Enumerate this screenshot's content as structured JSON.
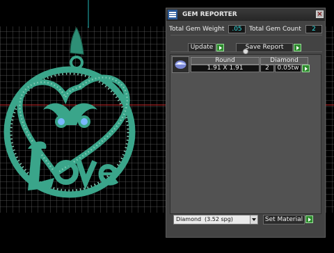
{
  "viewport": {
    "name": "3d-design-viewport",
    "grid_color": "#6e6e6e",
    "model_color": "#3aa58a",
    "gem_color": "#7ab8ff"
  },
  "panel": {
    "title": "GEM REPORTER",
    "close_glyph": "×",
    "total_weight_label": "Total Gem Weight",
    "total_weight_value": ".05",
    "total_count_label": "Total Gem Count",
    "total_count_value": "2",
    "update_label": "Update",
    "save_report_label": "Save Report",
    "table": {
      "headers": [
        "Round",
        "Diamond"
      ],
      "rows": [
        {
          "size": "1.91 X 1.91",
          "count": "2",
          "weight": "0.05tw"
        }
      ]
    },
    "material_select": {
      "value": "Diamond",
      "spg": "(3.52 spg)"
    },
    "set_material_label": "Set Material"
  },
  "icons": {
    "app": "gem-reporter-app-icon",
    "close": "close-icon",
    "arrow": "play-arrow-icon",
    "gem_thumb": "round-gem-icon",
    "dropdown": "chevron-down-icon"
  },
  "colors": {
    "accent_value": "#35e0e4",
    "button_green": "#2e8a2e"
  }
}
